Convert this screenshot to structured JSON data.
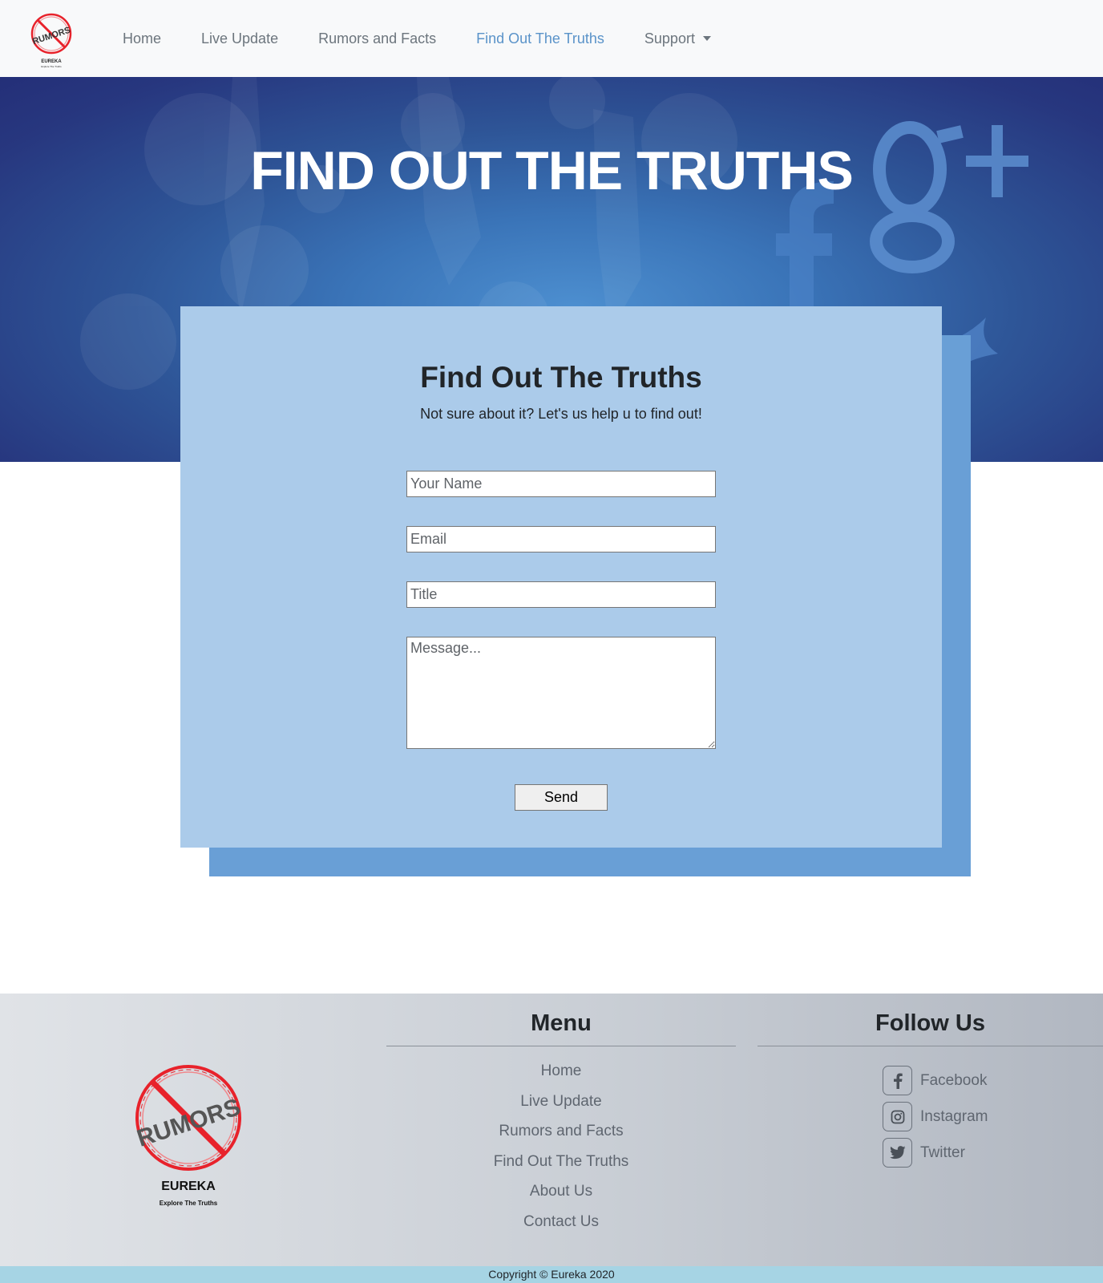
{
  "brand": {
    "logo_text": "RUMORS",
    "name": "EUREKA",
    "tagline": "Explore The Truths"
  },
  "nav": {
    "items": [
      {
        "label": "Home"
      },
      {
        "label": "Live Update"
      },
      {
        "label": "Rumors and Facts"
      },
      {
        "label": "Find Out The Truths"
      },
      {
        "label": "Support"
      }
    ],
    "active": "Find Out The Truths"
  },
  "hero": {
    "title": "FIND OUT THE TRUTHS"
  },
  "form": {
    "title": "Find Out The Truths",
    "subtitle": "Not sure about it? Let's us help u to find out!",
    "name_placeholder": "Your Name",
    "email_placeholder": "Email",
    "title_placeholder": "Title",
    "message_placeholder": "Message...",
    "send_label": "Send"
  },
  "footer": {
    "menu_heading": "Menu",
    "menu_items": [
      {
        "label": "Home"
      },
      {
        "label": "Live Update"
      },
      {
        "label": "Rumors and Facts"
      },
      {
        "label": "Find Out The Truths"
      },
      {
        "label": "About Us"
      },
      {
        "label": "Contact Us"
      }
    ],
    "follow_heading": "Follow Us",
    "social": [
      {
        "label": "Facebook",
        "icon": "facebook-icon"
      },
      {
        "label": "Instagram",
        "icon": "instagram-icon"
      },
      {
        "label": "Twitter",
        "icon": "twitter-icon"
      }
    ],
    "copyright": "Copyright © Eureka 2020"
  },
  "colors": {
    "nav_active": "#5a93c9",
    "card": "#abcbea",
    "card_shadow": "#699fd6",
    "hero_dark": "#242f78",
    "hero_light": "#4d8fd0",
    "copyright_bar": "#a6d4e4",
    "logo_red": "#e8222b"
  }
}
